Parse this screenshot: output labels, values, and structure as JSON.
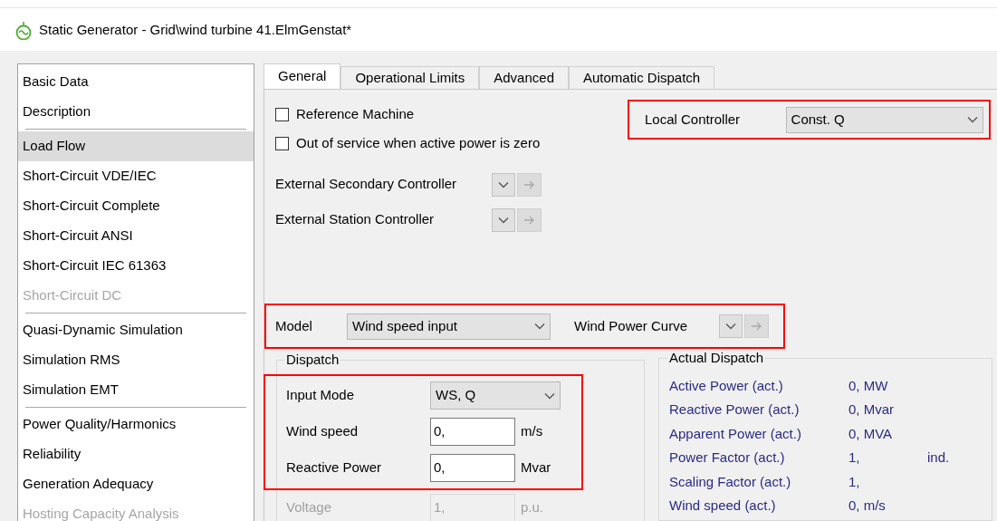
{
  "window": {
    "title": "Static Generator - Grid\\wind turbine 41.ElmGenstat*"
  },
  "sidebar": {
    "groups": [
      {
        "items": [
          {
            "label": "Basic Data",
            "selected": false,
            "disabled": false
          },
          {
            "label": "Description",
            "selected": false,
            "disabled": false
          }
        ]
      },
      {
        "items": [
          {
            "label": "Load Flow",
            "selected": true,
            "disabled": false
          },
          {
            "label": "Short-Circuit VDE/IEC",
            "selected": false,
            "disabled": false
          },
          {
            "label": "Short-Circuit Complete",
            "selected": false,
            "disabled": false
          },
          {
            "label": "Short-Circuit ANSI",
            "selected": false,
            "disabled": false
          },
          {
            "label": "Short-Circuit IEC 61363",
            "selected": false,
            "disabled": false
          },
          {
            "label": "Short-Circuit DC",
            "selected": false,
            "disabled": true
          }
        ]
      },
      {
        "items": [
          {
            "label": "Quasi-Dynamic Simulation",
            "selected": false,
            "disabled": false
          },
          {
            "label": "Simulation RMS",
            "selected": false,
            "disabled": false
          },
          {
            "label": "Simulation EMT",
            "selected": false,
            "disabled": false
          }
        ]
      },
      {
        "items": [
          {
            "label": "Power Quality/Harmonics",
            "selected": false,
            "disabled": false
          },
          {
            "label": "Reliability",
            "selected": false,
            "disabled": false
          },
          {
            "label": "Generation Adequacy",
            "selected": false,
            "disabled": false
          },
          {
            "label": "Hosting Capacity Analysis",
            "selected": false,
            "disabled": true
          }
        ]
      }
    ]
  },
  "tabs": [
    {
      "label": "General",
      "selected": true
    },
    {
      "label": "Operational Limits",
      "selected": false
    },
    {
      "label": "Advanced",
      "selected": false
    },
    {
      "label": "Automatic Dispatch",
      "selected": false
    }
  ],
  "general": {
    "checkboxes": [
      {
        "label": "Reference Machine",
        "checked": false
      },
      {
        "label": "Out of service when active power is zero",
        "checked": false
      }
    ],
    "controllers": [
      {
        "label": "External Secondary Controller"
      },
      {
        "label": "External Station Controller"
      }
    ],
    "local_controller": {
      "label": "Local Controller",
      "value": "Const. Q",
      "highlighted": true
    },
    "model": {
      "label": "Model",
      "value": "Wind speed input",
      "curve_label": "Wind Power Curve",
      "highlighted": true
    },
    "dispatch": {
      "title": "Dispatch",
      "rows": [
        {
          "kind": "combo",
          "label": "Input Mode",
          "value": "WS, Q",
          "disabled": false,
          "highlighted": true
        },
        {
          "kind": "field",
          "label": "Wind speed",
          "value": "0,",
          "unit": "m/s",
          "disabled": false,
          "highlighted": true
        },
        {
          "kind": "field",
          "label": "Reactive Power",
          "value": "0,",
          "unit": "Mvar",
          "disabled": false,
          "highlighted": true
        },
        {
          "kind": "field",
          "label": "Voltage",
          "value": "1,",
          "unit": "p.u.",
          "disabled": true,
          "highlighted": false
        }
      ]
    },
    "actual_dispatch": {
      "title": "Actual Dispatch",
      "rows": [
        {
          "label": "Active Power (act.)",
          "value": "0, MW"
        },
        {
          "label": "Reactive Power (act.)",
          "value": "0, Mvar"
        },
        {
          "label": "Apparent Power (act.)",
          "value": "0, MVA"
        },
        {
          "label": "Power Factor (act.)",
          "value": "1,",
          "extra": "ind."
        },
        {
          "label": "Scaling Factor (act.)",
          "value": "1,"
        },
        {
          "label": "Wind speed (act.)",
          "value": "0, m/s"
        }
      ]
    }
  }
}
